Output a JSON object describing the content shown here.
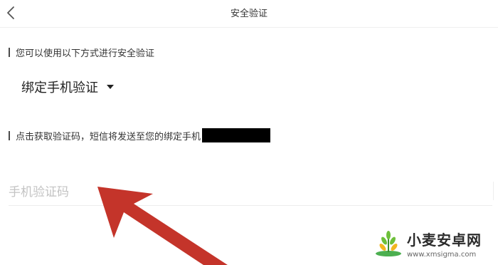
{
  "header": {
    "title": "安全验证"
  },
  "section1": {
    "label": "您可以使用以下方式进行安全验证"
  },
  "method": {
    "selected": "绑定手机验证"
  },
  "section2": {
    "label": "点击获取验证码，短信将发送至您的绑定手机"
  },
  "code_input": {
    "placeholder": "手机验证码",
    "value": ""
  },
  "watermark": {
    "name": "小麦安卓网",
    "url": "www.xmsigma.com"
  },
  "colors": {
    "arrow": "#c4342a",
    "text": "#333333",
    "placeholder": "#c3c3c3"
  },
  "icons": {
    "back": "chevron-left-icon",
    "dropdown": "caret-down-icon",
    "annotation": "red-arrow-icon"
  }
}
